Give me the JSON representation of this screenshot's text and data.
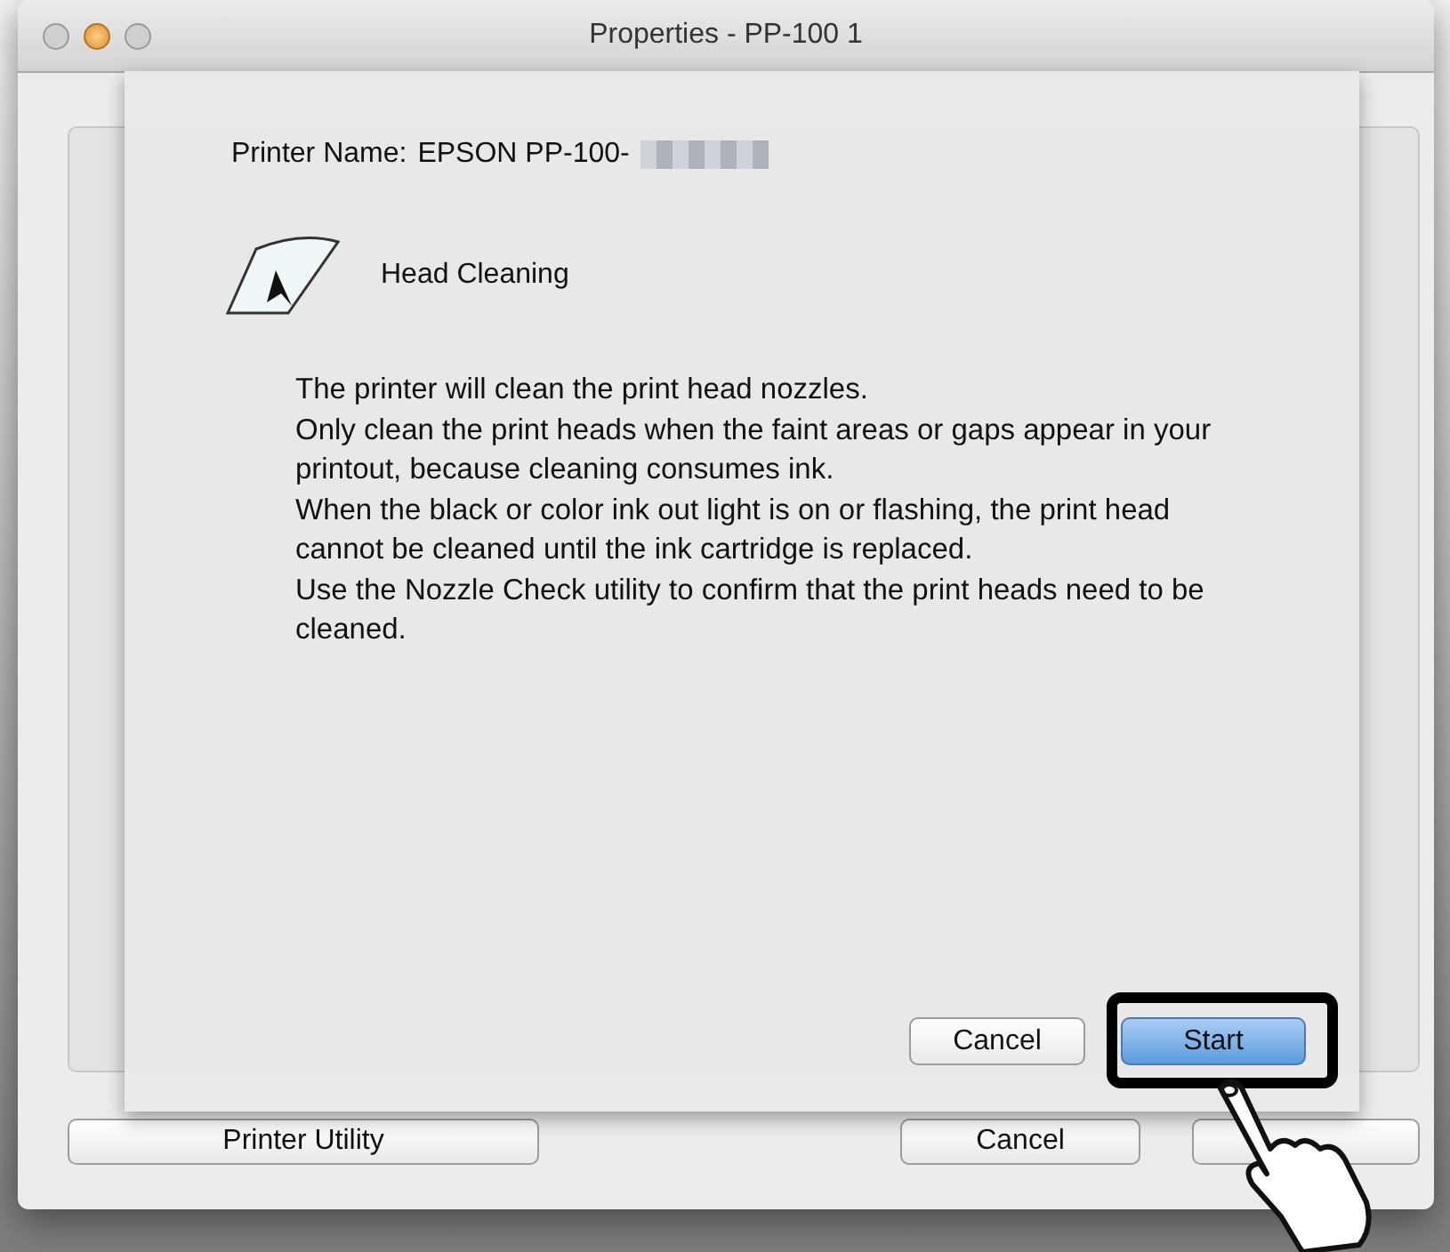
{
  "window": {
    "title": "Properties - PP-100 1"
  },
  "sheet": {
    "printer_label": "Printer Name:",
    "printer_name": "EPSON PP-100-",
    "heading": "Head Cleaning",
    "paragraphs": [
      "The printer will clean the print head nozzles.",
      "Only clean the print heads when the faint areas or gaps appear in your printout, because cleaning consumes ink.",
      "When the black or color ink out light is on or flashing, the print head cannot be cleaned until the ink cartridge is replaced.",
      "Use the Nozzle Check utility to confirm that the print heads need to be cleaned."
    ],
    "buttons": [
      {
        "label": "Cancel",
        "kind": "normal"
      },
      {
        "label": "Start",
        "kind": "default"
      }
    ]
  },
  "footer_buttons": [
    {
      "label": "Printer Utility"
    },
    {
      "label": "Cancel"
    }
  ]
}
